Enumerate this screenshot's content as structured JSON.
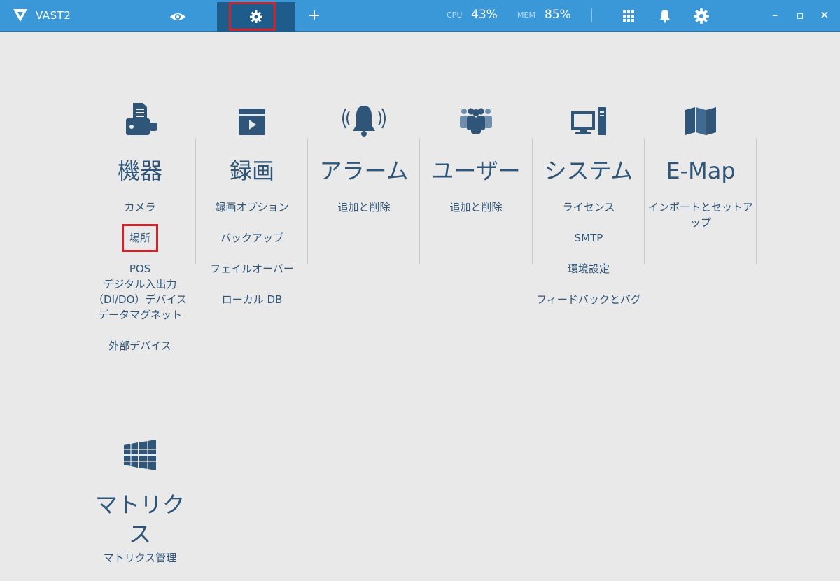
{
  "titlebar": {
    "app_name": "VAST2",
    "add_tab": "+",
    "cpu_label": "CPU",
    "cpu_value": "43%",
    "mem_label": "MEM",
    "mem_value": "85%",
    "minimize": "–",
    "maximize": "▫",
    "close": "✕"
  },
  "columns": [
    {
      "id": "device",
      "title": "機器",
      "icon": "device-icon",
      "links": [
        "カメラ",
        "場所",
        "POS",
        "デジタル入出力（DI/DO）デバイス",
        "データマグネット",
        "外部デバイス"
      ]
    },
    {
      "id": "recording",
      "title": "録画",
      "icon": "recording-icon",
      "links": [
        "録画オプション",
        "バックアップ",
        "フェイルオーバー",
        "ローカル DB"
      ]
    },
    {
      "id": "alarm",
      "title": "アラーム",
      "icon": "alarm-bell-icon",
      "links": [
        "追加と削除"
      ]
    },
    {
      "id": "user",
      "title": "ユーザー",
      "icon": "users-icon",
      "links": [
        "追加と削除"
      ]
    },
    {
      "id": "system",
      "title": "システム",
      "icon": "computer-icon",
      "links": [
        "ライセンス",
        "SMTP",
        "環境設定",
        "フィードバックとバグ"
      ]
    },
    {
      "id": "emap",
      "title": "E-Map",
      "icon": "map-icon",
      "links": [
        "インポートとセットアップ"
      ]
    }
  ],
  "matrix": {
    "title": "マトリクス",
    "icon": "windows-grid-icon",
    "link": "マトリクス管理"
  },
  "colors": {
    "topbar": "#3a97d8",
    "active_tab": "#1e5d8b",
    "highlight": "#d1232a",
    "text": "#2f5679",
    "background": "#e9e9e9"
  }
}
